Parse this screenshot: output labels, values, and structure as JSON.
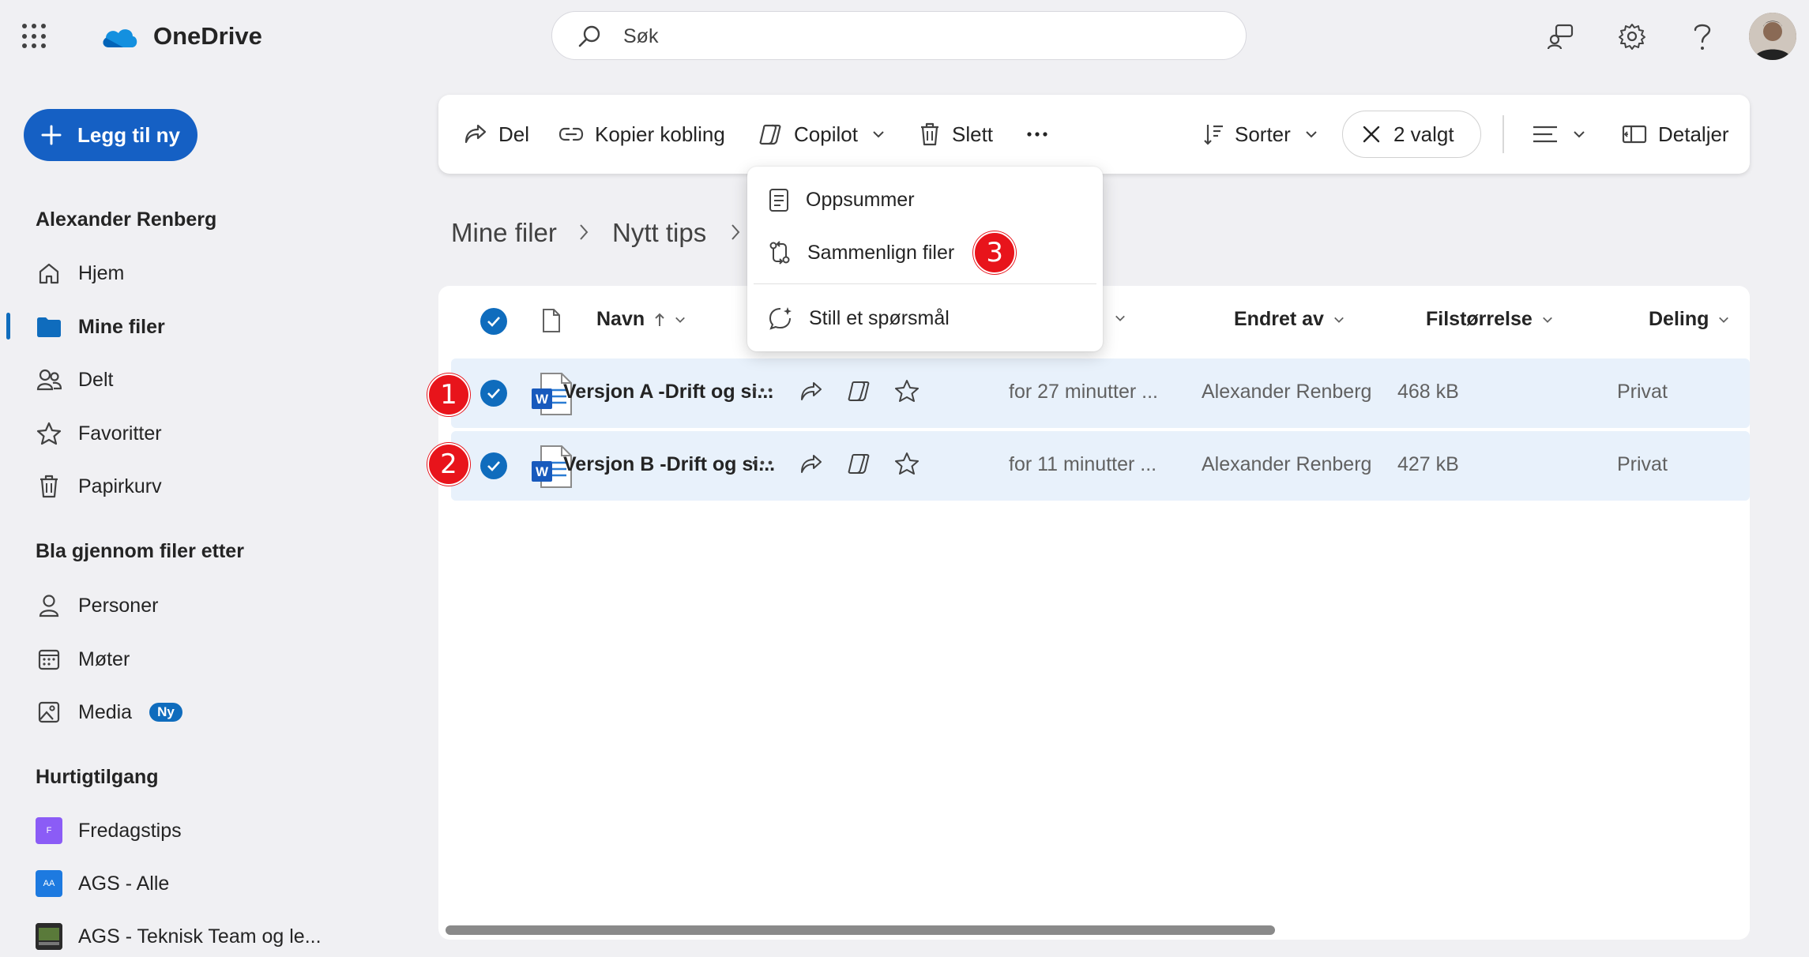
{
  "app": {
    "brand": "OneDrive"
  },
  "search": {
    "placeholder": "Søk"
  },
  "sidebar": {
    "new_button": "Legg til ny",
    "user_name": "Alexander Renberg",
    "nav": [
      {
        "label": "Hjem",
        "icon": "home-icon"
      },
      {
        "label": "Mine filer",
        "icon": "folder-icon",
        "active": true
      },
      {
        "label": "Delt",
        "icon": "people-icon"
      },
      {
        "label": "Favoritter",
        "icon": "star-icon"
      },
      {
        "label": "Papirkurv",
        "icon": "trash-icon"
      }
    ],
    "browse_heading": "Bla gjennom filer etter",
    "browse": [
      {
        "label": "Personer",
        "icon": "person-icon"
      },
      {
        "label": "Møter",
        "icon": "calendar-icon"
      },
      {
        "label": "Media",
        "icon": "image-icon",
        "badge": "Ny"
      }
    ],
    "quick_heading": "Hurtigtilgang",
    "quick": [
      {
        "label": "Fredagstips",
        "tile": "F",
        "color": "#8b5cf6"
      },
      {
        "label": "AGS - Alle",
        "tile": "AA",
        "color": "#1d7ae0"
      },
      {
        "label": "AGS - Teknisk Team og le...",
        "tile": "",
        "color": "#2b2b2b"
      }
    ]
  },
  "toolbar": {
    "share": "Del",
    "copy_link": "Kopier kobling",
    "copilot": "Copilot",
    "delete": "Slett",
    "more": "...",
    "sort": "Sorter",
    "selected": "2 valgt",
    "details": "Detaljer"
  },
  "breadcrumb": [
    "Mine filer",
    "Nytt tips"
  ],
  "copilot_menu": {
    "items": [
      {
        "label": "Oppsummer",
        "icon": "summary-icon"
      },
      {
        "label": "Sammenlign filer",
        "icon": "compare-icon"
      },
      {
        "label": "Still et spørsmål",
        "icon": "ask-icon"
      }
    ]
  },
  "table": {
    "columns": {
      "name": "Navn",
      "modified_by": "Endret av",
      "size": "Filstørrelse",
      "sharing": "Deling"
    },
    "rows": [
      {
        "name": "Versjon A -Drift og si...",
        "modified": "for 27 minutter ...",
        "modified_by": "Alexander Renberg",
        "size": "468 kB",
        "sharing": "Privat"
      },
      {
        "name": "Versjon B -Drift og si...",
        "modified": "for 11 minutter ...",
        "modified_by": "Alexander Renberg",
        "size": "427 kB",
        "sharing": "Privat"
      }
    ]
  },
  "annotations": [
    "1",
    "2",
    "3"
  ],
  "colors": {
    "accent": "#0f6cbd",
    "new_button": "#1560c4",
    "selected_row": "#e8f1fb",
    "marker": "#e8141b"
  }
}
